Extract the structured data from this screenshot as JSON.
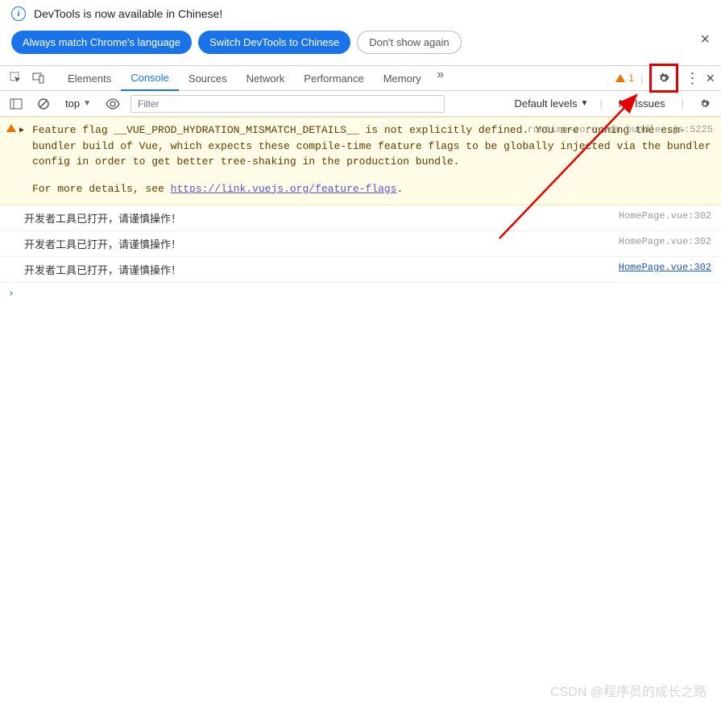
{
  "infobar": {
    "message": "DevTools is now available in Chinese!",
    "buttons": {
      "always_match": "Always match Chrome's language",
      "switch_chinese": "Switch DevTools to Chinese",
      "dont_show": "Don't show again"
    }
  },
  "tabs": {
    "elements": "Elements",
    "console": "Console",
    "sources": "Sources",
    "network": "Network",
    "performance": "Performance",
    "memory": "Memory",
    "warning_count": "1"
  },
  "console_toolbar": {
    "context": "top",
    "filter_placeholder": "Filter",
    "levels": "Default levels",
    "issues": "No Issues"
  },
  "messages": {
    "warning": {
      "text_1": "Feature flag __VUE_PROD_HYDRATION_MISMATCH_DETAILS__ is not explicitly defined. You are running the esm-bundler build of Vue, which expects these compile-time feature flags to be globally injected via the bundler config in order to get better tree-shaking in the production bundle.",
      "text_2a": "For more details, see ",
      "link": "https://link.vuejs.org/feature-flags",
      "text_2b": ".",
      "source": "runtime-core.esm-bundler.js:5225"
    },
    "log1": {
      "text": "开发者工具已打开，请谨慎操作！",
      "source": "HomePage.vue:302"
    },
    "log2": {
      "text": "开发者工具已打开，请谨慎操作！",
      "source": "HomePage.vue:302"
    },
    "log3": {
      "text": "开发者工具已打开，请谨慎操作！",
      "source": "HomePage.vue:302"
    }
  },
  "prompt_symbol": "›",
  "watermark": "CSDN @程序员的成长之路"
}
